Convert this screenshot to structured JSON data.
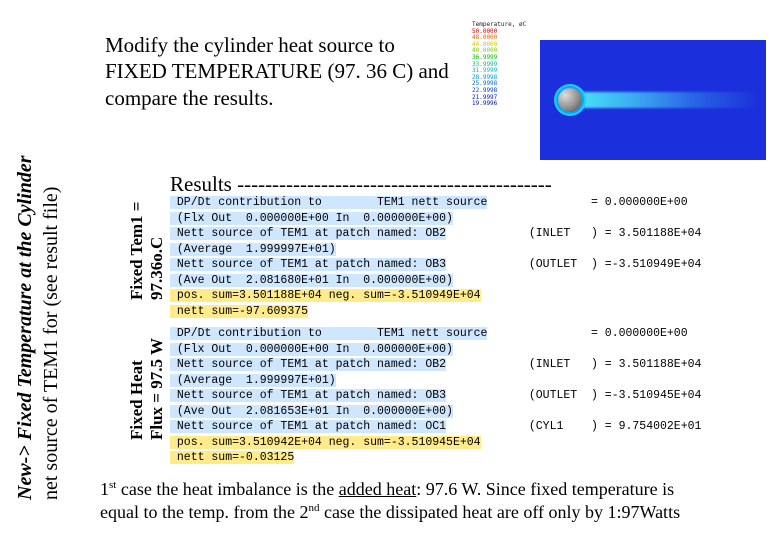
{
  "sideTitle": {
    "line1_prefix": "New-> Fixed Temperature at the Cylinder",
    "line2": "net source of TEM1 for (see result file)"
  },
  "instruction": "Modify the cylinder heat source to FIXED TEMPERATURE (97. 36 C) and compare the results.",
  "chartLegend": {
    "title": "Temperature, øC",
    "lines": [
      "50.0000",
      "48.0000",
      "44.0000",
      "40.0000",
      "36.9999",
      "33.9999",
      "31.9999",
      "28.9998",
      "25.9998",
      "22.9998",
      "21.9997",
      "19.9996"
    ]
  },
  "resultsHeader": "Results ---------------------------------------------",
  "labels": {
    "block1_a": "Fixed Tem1 =",
    "block1_b": "97.36o.C",
    "block2_a": "Fixed Heat",
    "block2_b": "Flux = 97.5 W"
  },
  "block1": {
    "l1_left": " DP/Dt contribution to        TEM1 nett source",
    "l1_right": "= 0.000000E+00",
    "l2": " (Flx Out  0.000000E+00 In  0.000000E+00)",
    "l3_left": " Nett source of TEM1 at patch named: OB2",
    "l3_tag": "(INLET   )",
    "l3_right": "= 3.501188E+04",
    "l4": " (Average  1.999997E+01)",
    "l5_left": " Nett source of TEM1 at patch named: OB3",
    "l5_tag": "(OUTLET  )",
    "l5_right": "=-3.510949E+04",
    "l6": " (Ave Out  2.081680E+01 In  0.000000E+00)",
    "l7": " pos. sum=3.501188E+04 neg. sum=-3.510949E+04",
    "l8": " nett sum=-97.609375"
  },
  "block2": {
    "l1_left": " DP/Dt contribution to        TEM1 nett source",
    "l1_right": "= 0.000000E+00",
    "l2": " (Flx Out  0.000000E+00 In  0.000000E+00)",
    "l3_left": " Nett source of TEM1 at patch named: OB2",
    "l3_tag": "(INLET   )",
    "l3_right": "= 3.501188E+04",
    "l4": " (Average  1.999997E+01)",
    "l5_left": " Nett source of TEM1 at patch named: OB3",
    "l5_tag": "(OUTLET  )",
    "l5_right": "=-3.510945E+04",
    "l6": " (Ave Out  2.081653E+01 In  0.000000E+00)",
    "l7_left": " Nett source of TEM1 at patch named: OC1",
    "l7_tag": "(CYL1    )",
    "l7_right": "= 9.754002E+01",
    "l8": " pos. sum=3.510942E+04 neg. sum=-3.510945E+04",
    "l9": " nett sum=-0.03125"
  },
  "footnote": {
    "p1a": "1",
    "p1sup": "st",
    "p1b": " case the heat imbalance is the ",
    "p1c": "added heat",
    "p1d": ": 97.6 W. Since fixed temperature is",
    "p2a": "equal to the temp. from the 2",
    "p2sup": "nd",
    "p2b": " case the dissipated heat are off only by 1:97Watts"
  }
}
